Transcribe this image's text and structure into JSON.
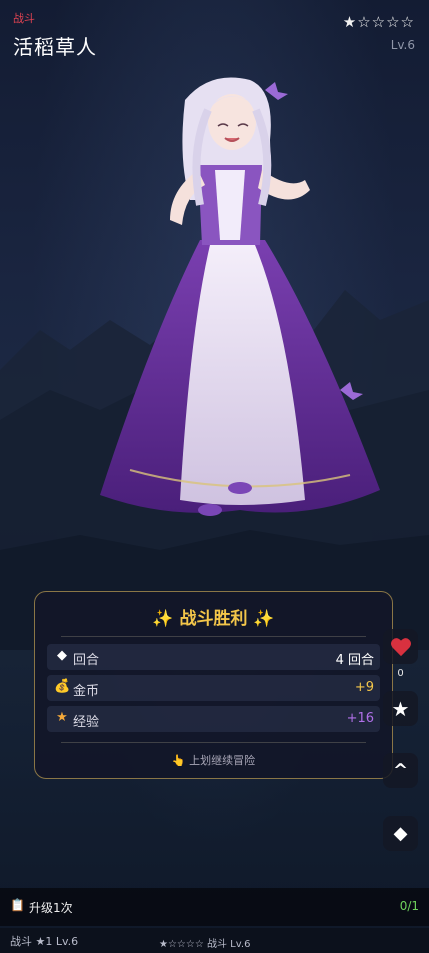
{
  "header": {
    "tag": "战斗",
    "title": "活稻草人",
    "stars": "★☆☆☆☆",
    "level": "Lv.6"
  },
  "result_panel": {
    "title": "✨ 战斗胜利 ✨",
    "rows": [
      {
        "icon": "diamond-icon",
        "label": "回合",
        "value": "4 回合",
        "color": "#ffffff"
      },
      {
        "icon": "money-bag-icon",
        "label": "金币",
        "value": "+9",
        "color": "#f3c64a"
      },
      {
        "icon": "star-icon",
        "label": "经验",
        "value": "+16",
        "color": "#b070e8"
      }
    ],
    "hint": "👆 上划继续冒险"
  },
  "side": {
    "like_count": "0"
  },
  "upgrade": {
    "label": "升级1次",
    "progress": "0/1"
  },
  "footer": {
    "left": "战斗 ★1 Lv.6",
    "center": "★☆☆☆☆ 战斗 Lv.6"
  },
  "colors": {
    "accent_gold": "#f3c64a",
    "exp_purple": "#b070e8",
    "tag_red": "#e04352",
    "progress_green": "#6fd25c"
  }
}
